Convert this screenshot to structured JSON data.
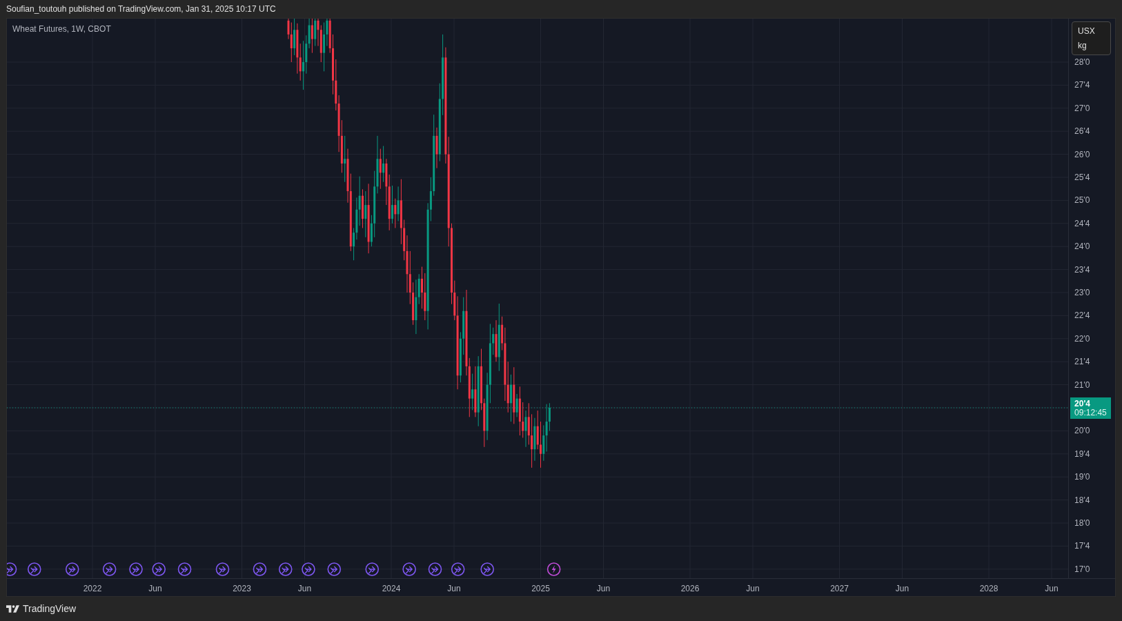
{
  "header": {
    "text": "Soufian_toutouh published on TradingView.com, Jan 31, 2025 10:17 UTC"
  },
  "chart": {
    "legend": "Wheat Futures, 1W, CBOT",
    "unit_box": {
      "currency": "USX",
      "unit": "kg"
    },
    "price_axis_above_last": [
      "28'0",
      "27'4",
      "27'0",
      "26'4",
      "26'0",
      "25'4",
      "25'0",
      "24'4",
      "24'0",
      "23'4",
      "23'0",
      "22'4",
      "22'0",
      "21'4",
      "21'0"
    ],
    "price_axis_below_last": [
      "20'0",
      "19'4",
      "19'0",
      "18'4",
      "18'0",
      "17'4",
      "17'0"
    ],
    "last_price": {
      "price": "20'4",
      "countdown": "09:12:45"
    },
    "time_axis": [
      "2022",
      "Jun",
      "2023",
      "Jun",
      "2024",
      "Jun",
      "2025",
      "Jun",
      "2026",
      "Jun",
      "2027",
      "Jun",
      "2028",
      "Jun"
    ]
  },
  "footer": {
    "brand": "TradingView"
  }
}
